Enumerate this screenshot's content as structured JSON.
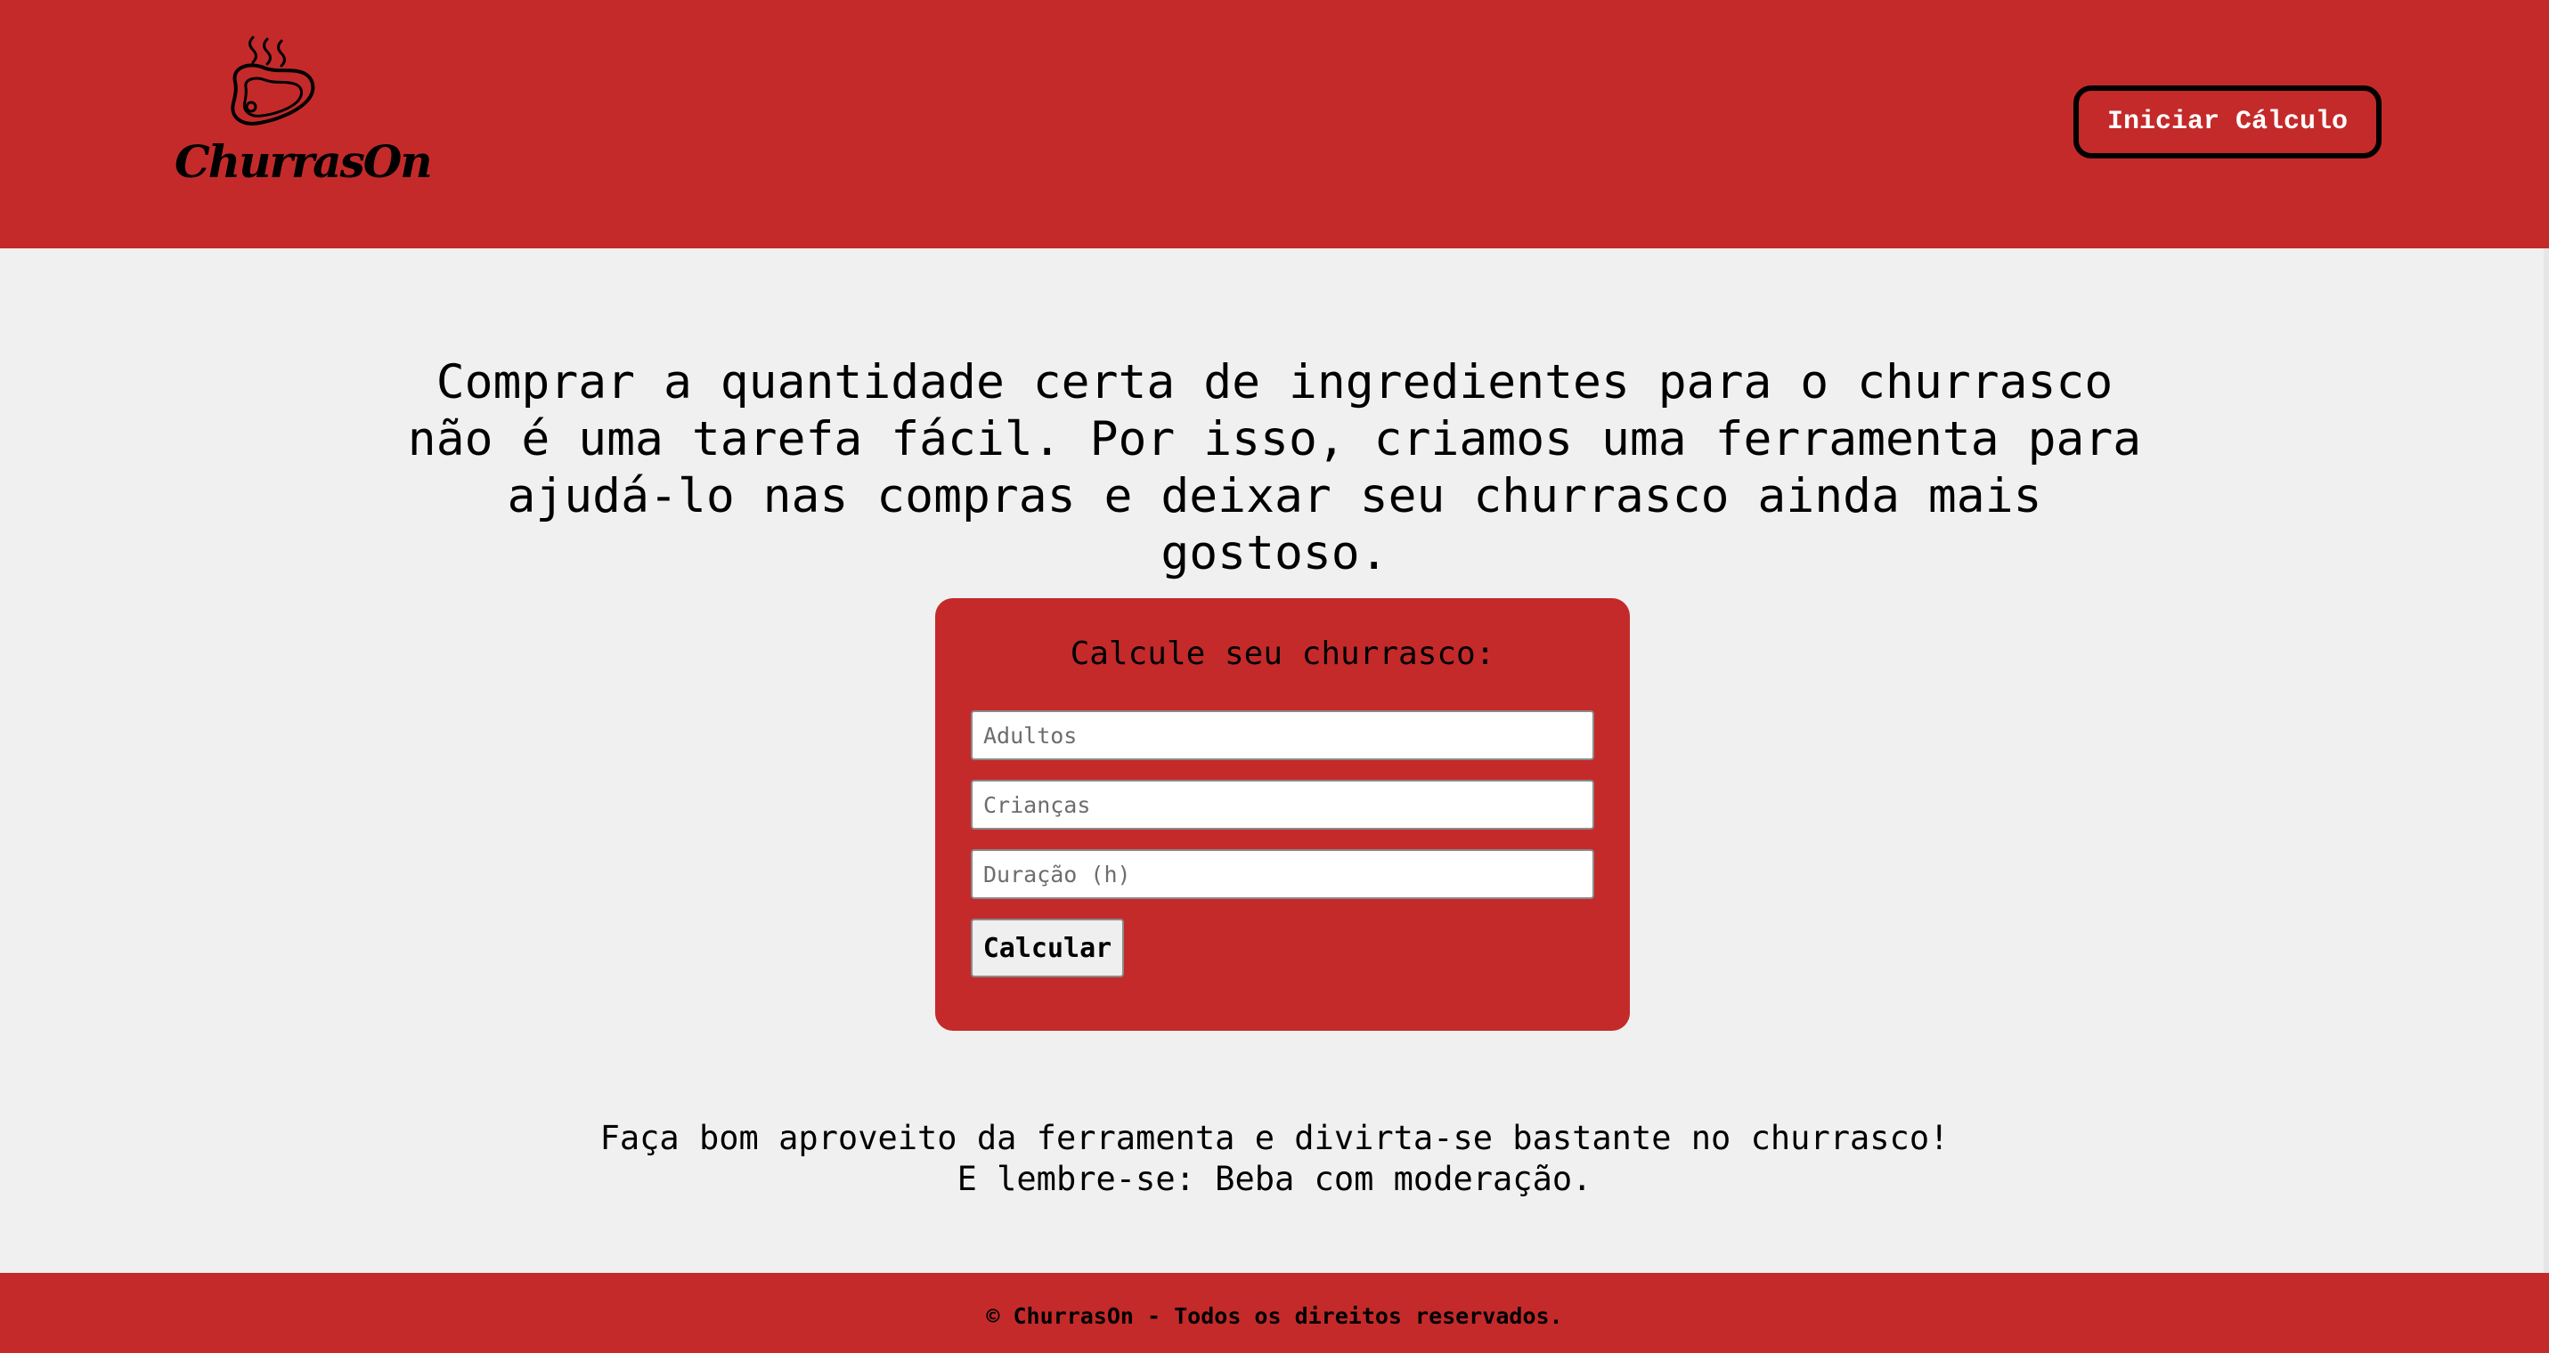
{
  "header": {
    "logo_text": "ChurrasOn",
    "logo_icon": "steaming-steak-icon",
    "start_button_label": "Iniciar Cálculo"
  },
  "main": {
    "intro_text": "Comprar a quantidade certa de ingredientes para o churrasco não é uma tarefa fácil. Por isso, criamos uma ferramenta para ajudá-lo nas compras e deixar seu churrasco ainda mais gostoso.",
    "calculator": {
      "title": "Calcule seu churrasco:",
      "adults_placeholder": "Adultos",
      "adults_value": "",
      "children_placeholder": "Crianças",
      "children_value": "",
      "duration_placeholder": "Duração (h)",
      "duration_value": "",
      "submit_label": "Calcular"
    },
    "closing_line_1": "Faça bom aproveito da ferramenta e divirta-se bastante no churrasco!",
    "closing_line_2": "E lembre-se: Beba com moderação."
  },
  "footer": {
    "copyright": "© ChurrasOn - Todos os direitos reservados."
  },
  "colors": {
    "brand_red": "#c42a2a",
    "page_background": "#f0f0f0"
  }
}
